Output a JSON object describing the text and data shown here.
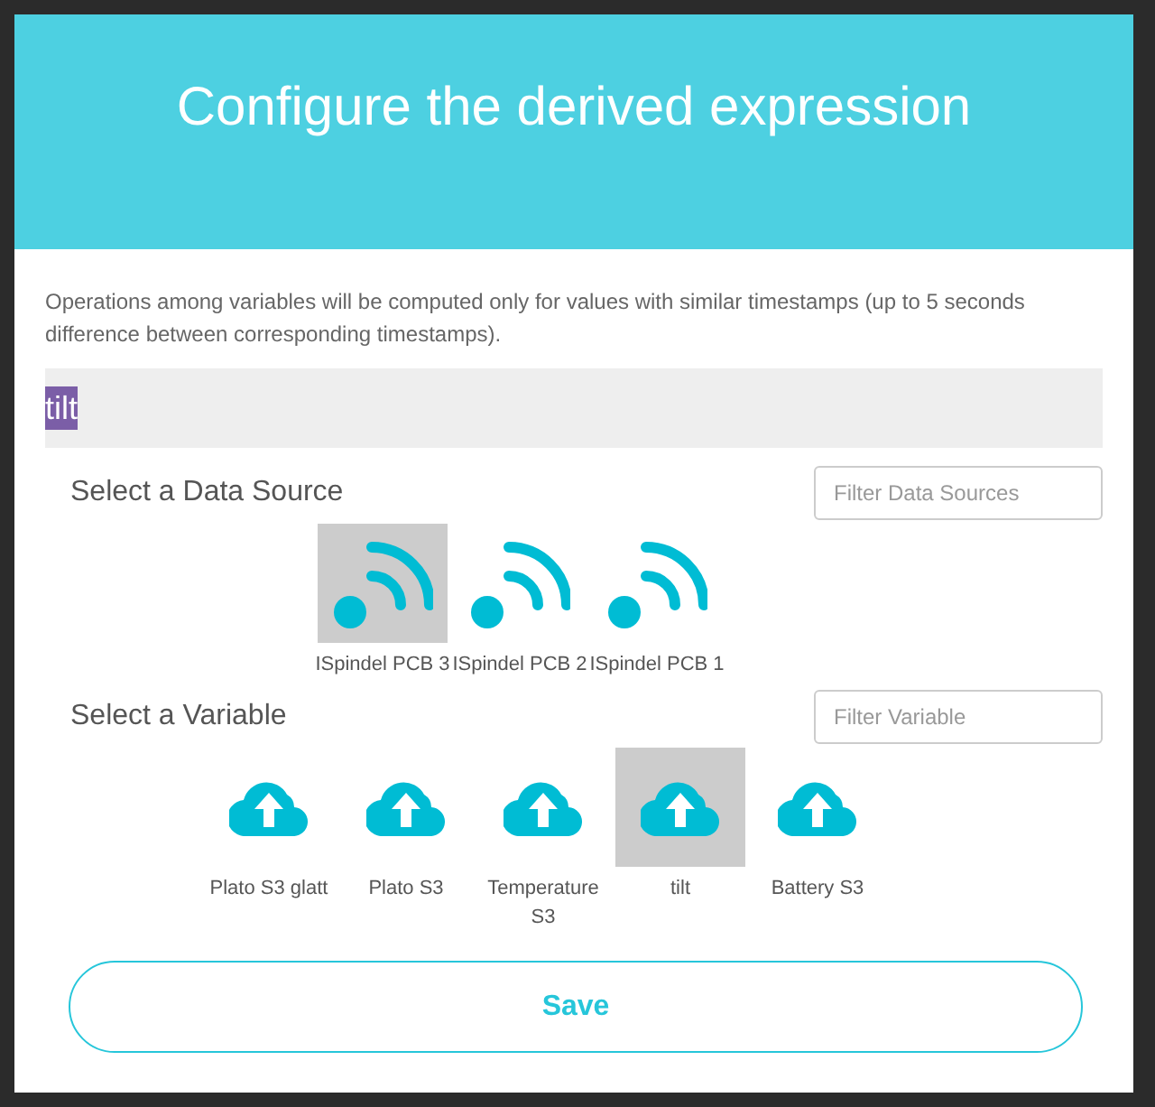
{
  "dialog": {
    "title": "Configure the derived expression"
  },
  "note": "Operations among variables will be computed only for values with similar timestamps (up to 5 seconds difference between corresponding timestamps).",
  "expression": {
    "value": "tilt",
    "selected": true
  },
  "data_sources": {
    "heading": "Select a Data Source",
    "filter": {
      "placeholder": "Filter Data Sources"
    },
    "items": [
      {
        "label": "ISpindel PCB 3",
        "selected": true
      },
      {
        "label": "ISpindel PCB 2",
        "selected": false
      },
      {
        "label": "ISpindel PCB 1",
        "selected": false
      }
    ]
  },
  "variables": {
    "heading": "Select a Variable",
    "filter": {
      "placeholder": "Filter Variable"
    },
    "items": [
      {
        "label": "Plato S3 glatt",
        "selected": false
      },
      {
        "label": "Plato S3",
        "selected": false
      },
      {
        "label": "Temperature S3",
        "selected": false
      },
      {
        "label": "tilt",
        "selected": true
      },
      {
        "label": "Battery S3",
        "selected": false
      }
    ]
  },
  "save_button": "Save"
}
